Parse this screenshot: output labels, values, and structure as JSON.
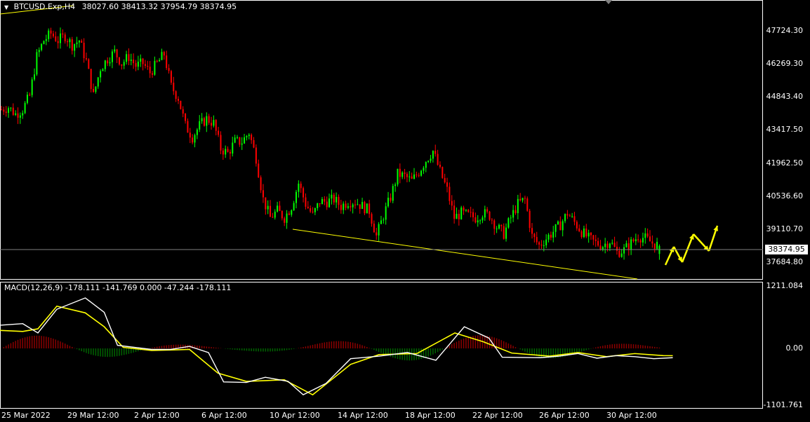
{
  "header": {
    "symbol": "BTCUSD.Exp,H4",
    "ohlc": "38027.60 38413.32 37954.79 38374.95"
  },
  "macd": {
    "label": "MACD(12,26,9) -178.111 -141.769 0.000 -47.244 -178.111",
    "axis_labels": [
      "1211.084",
      "0.00",
      "-1101.761"
    ],
    "ylim": [
      -1101.761,
      1211.084
    ]
  },
  "current_price": "38374.95",
  "colors": {
    "background": "#000000",
    "bull_candle": "#00ff00",
    "bear_candle": "#ff0000",
    "trendline": "#ffff00",
    "macd_line": "#ffffff",
    "signal_line": "#ffff00",
    "hist_pos": "#8b0000",
    "hist_neg": "#006400",
    "arrow": "#ffff00"
  },
  "chart_data": {
    "type": "candlestick",
    "symbol": "BTCUSD.Exp",
    "timeframe": "H4",
    "last_bar": {
      "open": 38027.6,
      "high": 38413.32,
      "low": 37954.79,
      "close": 38374.95
    },
    "price_ticks": [
      "47724.30",
      "46269.30",
      "44843.40",
      "43417.50",
      "41962.50",
      "40536.60",
      "39110.70",
      "37684.80"
    ],
    "ylim": [
      37000,
      48750
    ],
    "date_labels": [
      "25 Mar 2022",
      "29 Mar 12:00",
      "2 Apr 12:00",
      "6 Apr 12:00",
      "10 Apr 12:00",
      "14 Apr 12:00",
      "18 Apr 12:00",
      "22 Apr 12:00",
      "26 Apr 12:00",
      "30 Apr 12:00"
    ],
    "close_path": [
      [
        0,
        44300
      ],
      [
        3,
        44400
      ],
      [
        6,
        44100
      ],
      [
        9,
        44300
      ],
      [
        12,
        44900
      ],
      [
        15,
        46600
      ],
      [
        18,
        47300
      ],
      [
        21,
        47600
      ],
      [
        24,
        47300
      ],
      [
        27,
        47500
      ],
      [
        30,
        47100
      ],
      [
        33,
        47300
      ],
      [
        36,
        46400
      ],
      [
        39,
        44900
      ],
      [
        42,
        46100
      ],
      [
        45,
        46500
      ],
      [
        48,
        46800
      ],
      [
        51,
        46300
      ],
      [
        54,
        46600
      ],
      [
        57,
        46200
      ],
      [
        60,
        46300
      ],
      [
        63,
        45900
      ],
      [
        66,
        46300
      ],
      [
        69,
        46700
      ],
      [
        72,
        45300
      ],
      [
        75,
        44800
      ],
      [
        78,
        43600
      ],
      [
        81,
        43100
      ],
      [
        84,
        43600
      ],
      [
        87,
        43900
      ],
      [
        90,
        43700
      ],
      [
        93,
        42600
      ],
      [
        96,
        42400
      ],
      [
        99,
        42900
      ],
      [
        102,
        42900
      ],
      [
        105,
        43300
      ],
      [
        108,
        42200
      ],
      [
        111,
        40400
      ],
      [
        114,
        39600
      ],
      [
        117,
        39900
      ],
      [
        120,
        39600
      ],
      [
        123,
        40100
      ],
      [
        126,
        41100
      ],
      [
        129,
        40200
      ],
      [
        132,
        39700
      ],
      [
        135,
        40300
      ],
      [
        138,
        40300
      ],
      [
        141,
        40400
      ],
      [
        144,
        40100
      ],
      [
        147,
        40300
      ],
      [
        150,
        40300
      ],
      [
        153,
        40100
      ],
      [
        156,
        39900
      ],
      [
        159,
        38800
      ],
      [
        162,
        39700
      ],
      [
        165,
        40500
      ],
      [
        168,
        41500
      ],
      [
        171,
        41400
      ],
      [
        174,
        41200
      ],
      [
        177,
        41600
      ],
      [
        180,
        42100
      ],
      [
        183,
        42500
      ],
      [
        186,
        41600
      ],
      [
        189,
        40800
      ],
      [
        192,
        39600
      ],
      [
        195,
        39800
      ],
      [
        198,
        39700
      ],
      [
        201,
        39600
      ],
      [
        204,
        39800
      ],
      [
        207,
        39700
      ],
      [
        210,
        39200
      ],
      [
        213,
        38900
      ],
      [
        216,
        39600
      ],
      [
        219,
        40200
      ],
      [
        222,
        40400
      ],
      [
        225,
        38800
      ],
      [
        228,
        38400
      ],
      [
        231,
        38700
      ],
      [
        234,
        39000
      ],
      [
        237,
        39300
      ],
      [
        240,
        39800
      ],
      [
        243,
        39400
      ],
      [
        246,
        39000
      ],
      [
        249,
        38700
      ],
      [
        252,
        38500
      ],
      [
        255,
        38400
      ],
      [
        258,
        38600
      ],
      [
        261,
        38100
      ],
      [
        264,
        38200
      ],
      [
        267,
        38500
      ],
      [
        270,
        38800
      ],
      [
        273,
        38700
      ],
      [
        276,
        38500
      ],
      [
        279,
        38374.95
      ]
    ],
    "macd": {
      "name": "MACD(12,26,9)",
      "ylim": [
        -1101.761,
        1211.084
      ],
      "values_last": {
        "macd": -178.111,
        "signal": -141.769,
        "level": 0.0,
        "hist": -47.244
      }
    }
  }
}
